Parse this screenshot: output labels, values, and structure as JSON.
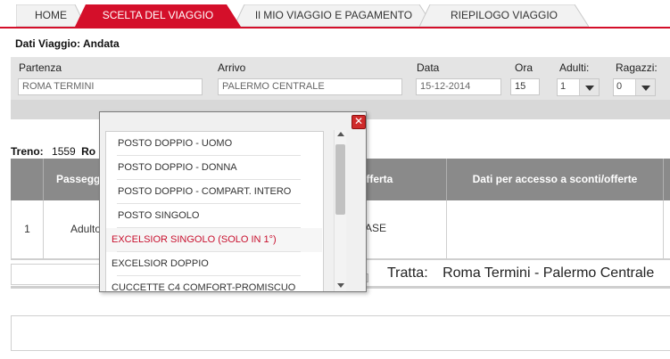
{
  "tabs": {
    "home": "HOME",
    "scelta": "SCELTA DEL VIAGGIO",
    "mio_viaggio": "Il MIO VIAGGIO E PAGAMENTO",
    "riepilogo": "RIEPILOGO VIAGGIO"
  },
  "dati_viaggio": "Dati Viaggio:  Andata",
  "form": {
    "partenza_label": "Partenza",
    "partenza_value": "ROMA TERMINI",
    "arrivo_label": "Arrivo",
    "arrivo_value": "PALERMO CENTRALE",
    "data_label": "Data",
    "data_value": "15-12-2014",
    "ora_label": "Ora",
    "ora_value": "15",
    "adulti_label": "Adulti:",
    "adulti_value": "1",
    "ragazzi_label": "Ragazzi:",
    "ragazzi_value": "0"
  },
  "treno": {
    "label": "Treno:",
    "number": "1559",
    "partial": "Ro"
  },
  "table": {
    "headers": {
      "passeggero": "Passegg",
      "offerta": "Offerta",
      "dati_sconti": "Dati per accesso a sconti/offerte"
    },
    "row": {
      "index": "1",
      "tipo": "Adulto",
      "offerta": "BASE"
    }
  },
  "tratta": {
    "label": "Tratta:",
    "value": "Roma Termini - Palermo Centrale"
  },
  "popup": {
    "close_glyph": "✕",
    "items": [
      "POSTO DOPPIO - UOMO",
      "POSTO DOPPIO - DONNA",
      "POSTO DOPPIO - COMPART. INTERO",
      "POSTO SINGOLO",
      "EXCELSIOR SINGOLO (SOLO IN 1°)",
      "EXCELSIOR DOPPIO",
      "CUCCETTE C4 COMFORT-PROMISCUO"
    ],
    "selected_index": 4
  },
  "colors": {
    "brand_red": "#d40f2a",
    "header_grey": "#8a8a8a",
    "selected_text": "#c8102e"
  }
}
